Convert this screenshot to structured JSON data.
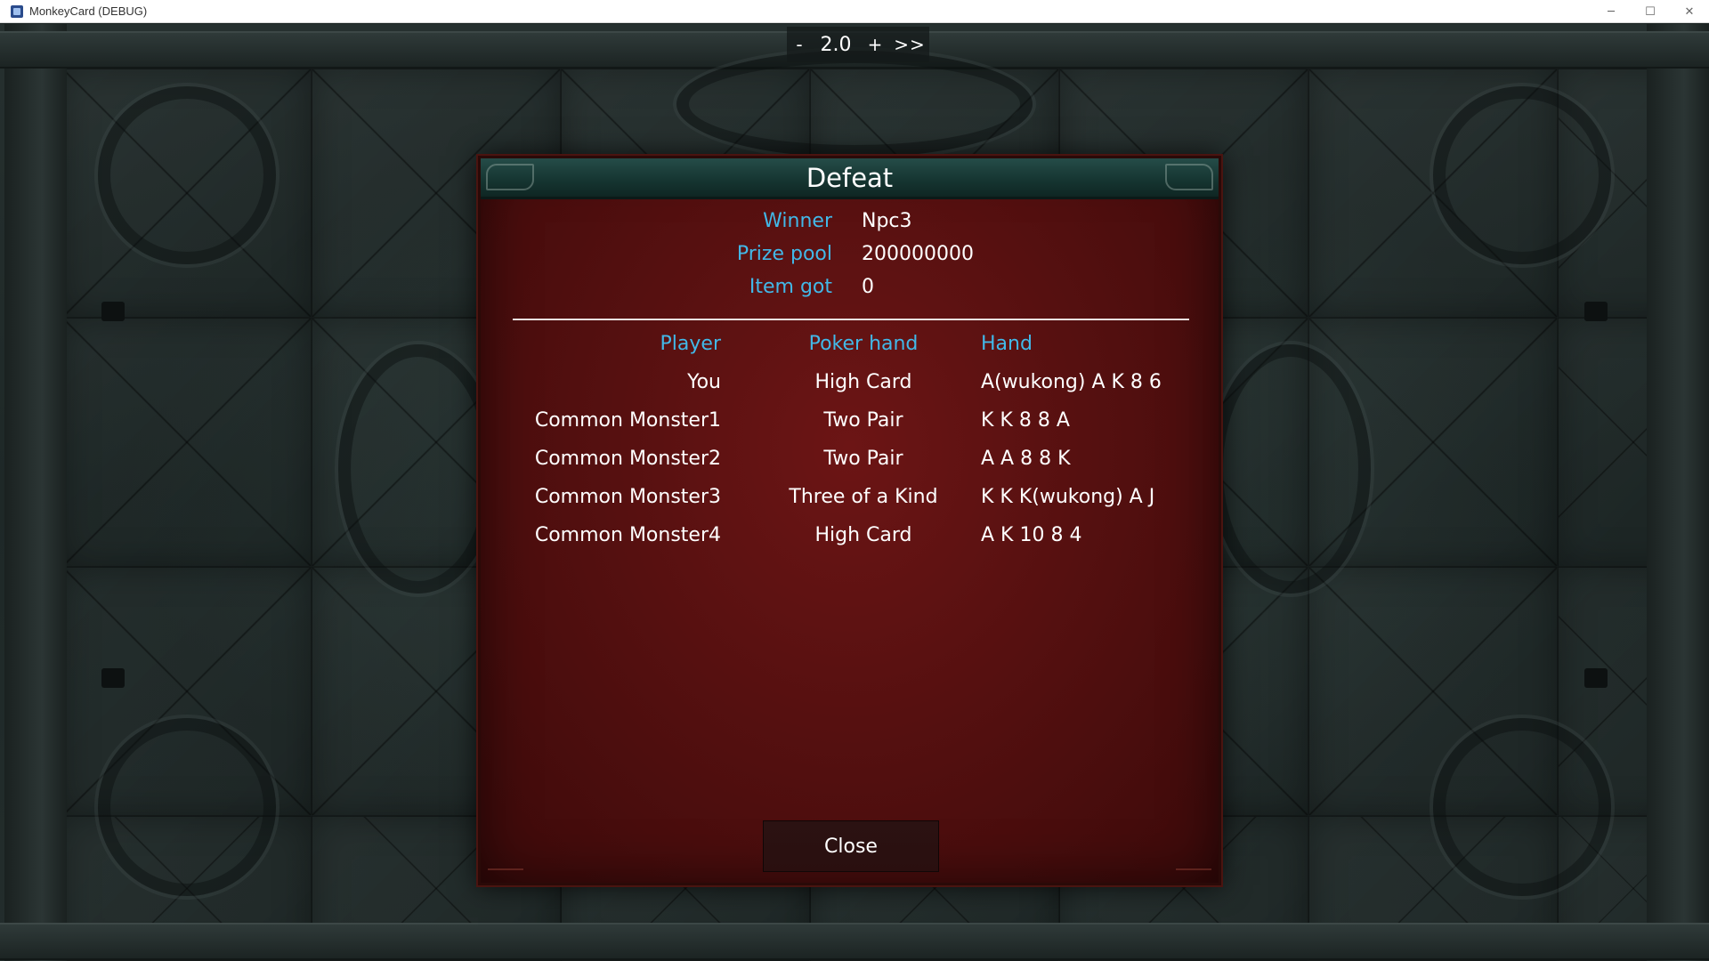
{
  "window": {
    "title": "MonkeyCard (DEBUG)",
    "minimize_glyph": "─",
    "maximize_glyph": "☐",
    "close_glyph": "✕"
  },
  "speed_control": {
    "decrease_label": "-",
    "value": "2.0",
    "increase_label": "+",
    "fast_forward_label": ">>"
  },
  "dialog": {
    "title": "Defeat",
    "summary": [
      {
        "label": "Winner",
        "value": "Npc3"
      },
      {
        "label": "Prize pool",
        "value": "200000000"
      },
      {
        "label": "Item got",
        "value": "0"
      }
    ],
    "columns": {
      "player": "Player",
      "poker_hand": "Poker hand",
      "hand": "Hand"
    },
    "rows": [
      {
        "player": "You",
        "poker_hand": "High Card",
        "hand": "A(wukong) A K 8 6"
      },
      {
        "player": "Common Monster1",
        "poker_hand": "Two Pair",
        "hand": "K K 8 8 A"
      },
      {
        "player": "Common Monster2",
        "poker_hand": "Two Pair",
        "hand": "A A 8 8 K"
      },
      {
        "player": "Common Monster3",
        "poker_hand": "Three of a Kind",
        "hand": "K K K(wukong) A J"
      },
      {
        "player": "Common Monster4",
        "poker_hand": "High Card",
        "hand": "A K 10 8 4"
      }
    ],
    "close_label": "Close"
  },
  "colors": {
    "header_accent": "#42b8e8",
    "dialog_red": "#5a1010",
    "dialog_header_teal": "#1a3c38"
  }
}
